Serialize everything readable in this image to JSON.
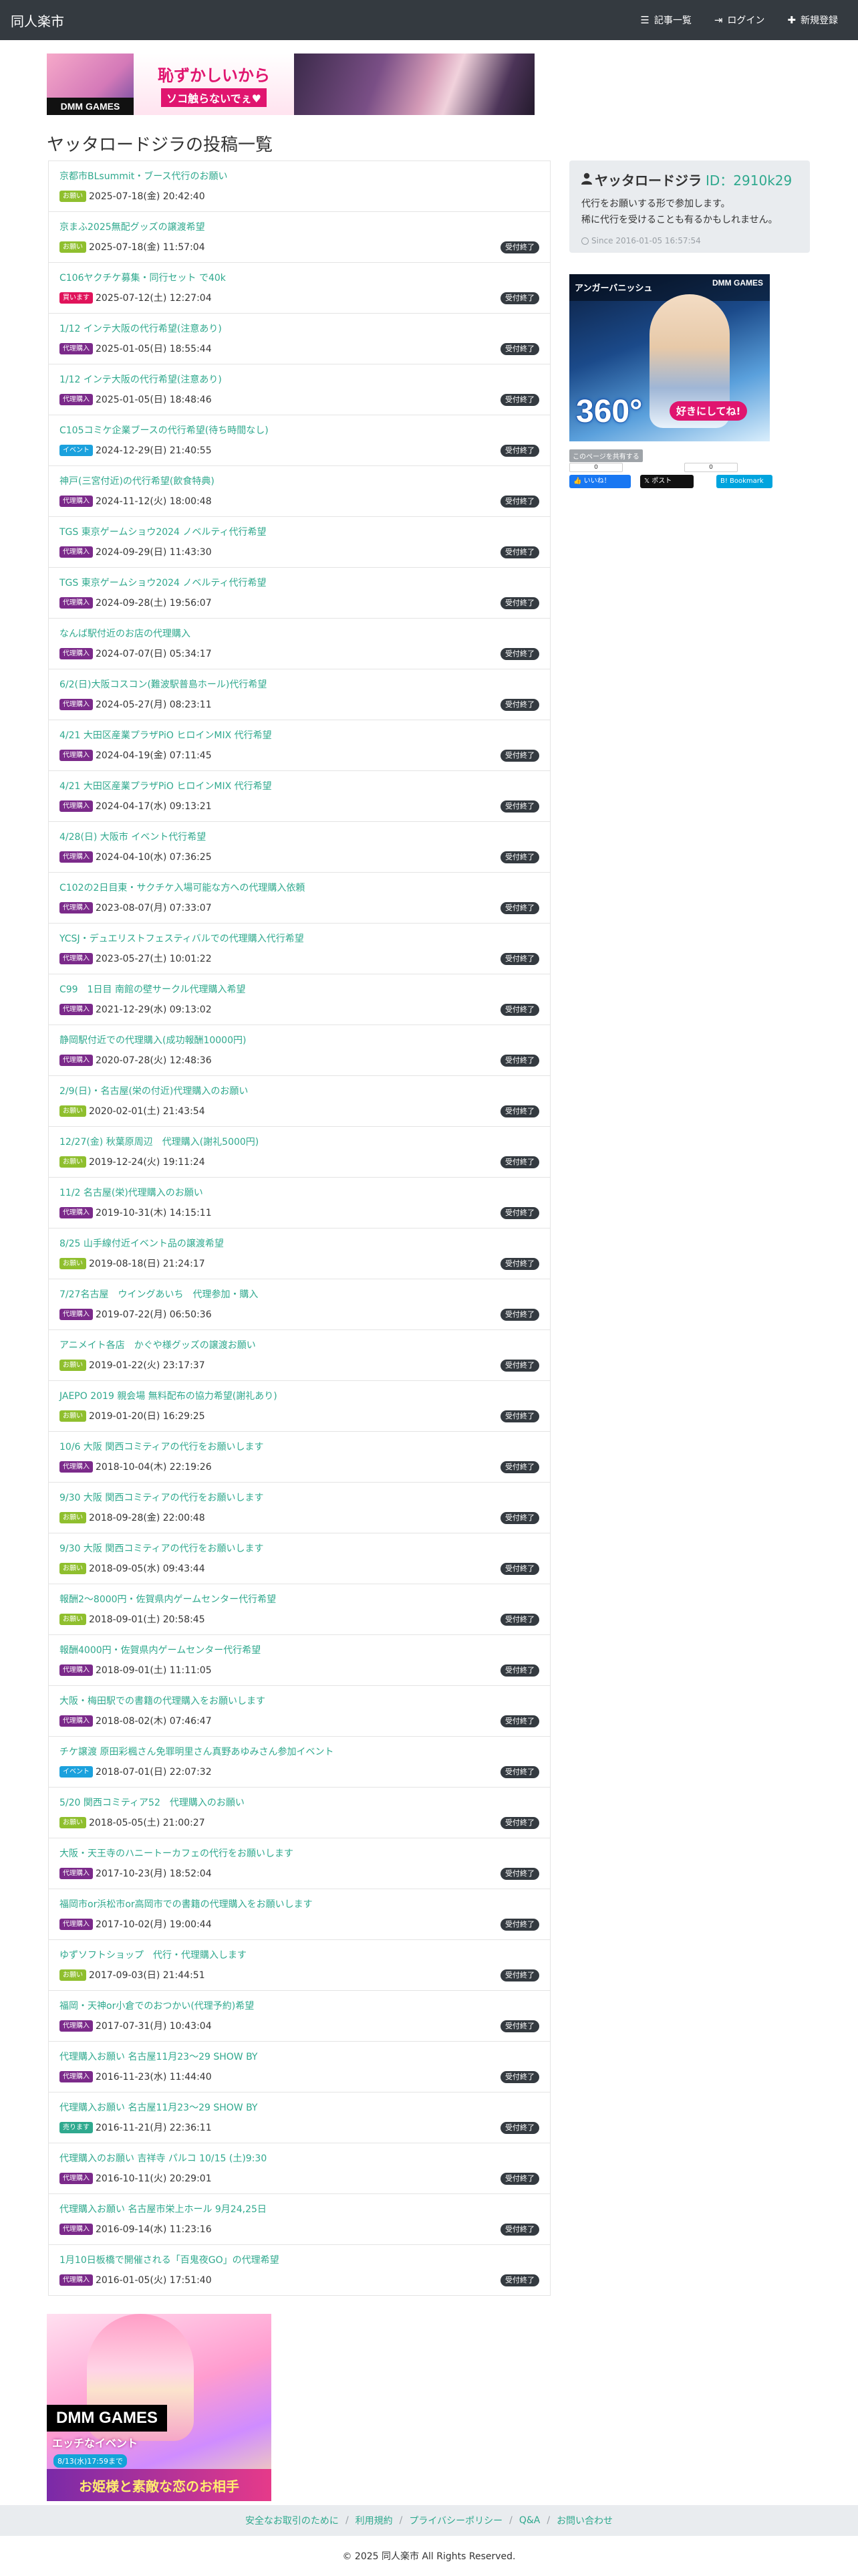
{
  "navbar": {
    "brand": "同人楽市",
    "links": [
      {
        "label": "記事一覧",
        "icon": "list-icon"
      },
      {
        "label": "ログイン",
        "icon": "sign-in-icon"
      },
      {
        "label": "新規登録",
        "icon": "plus-icon"
      }
    ]
  },
  "top_banner": {
    "brand": "DMM GAMES",
    "line1": "恥ずかしいから",
    "line2": "ソコ触らないでぇ♥"
  },
  "page_title": "ヤッタロードジラの投稿一覧",
  "colors": {
    "accent": "#2fa98e",
    "navbar": "#343a40",
    "cat_onegai": "#8fbf2e",
    "cat_daiko": "#7b2a8a",
    "cat_uri": "#e0135a",
    "cat_event": "#1ba1dd",
    "cat_kai": "#2fa98e"
  },
  "posts": [
    {
      "title": "京都市BLsummit・ブース代行のお願い",
      "category": "お願い",
      "cat_type": "onegai",
      "date": "2025-07-18(金) 20:42:40",
      "status": ""
    },
    {
      "title": "京まふ2025無配グッズの譲渡希望",
      "category": "お願い",
      "cat_type": "onegai",
      "date": "2025-07-18(金) 11:57:04",
      "status": "受付終了"
    },
    {
      "title": "C106ヤクチケ募集・同行セット で40k",
      "category": "買います",
      "cat_type": "uri",
      "date": "2025-07-12(土) 12:27:04",
      "status": "受付終了"
    },
    {
      "title": "1/12 インテ大阪の代行希望(注意あり)",
      "category": "代理購入",
      "cat_type": "daiko",
      "date": "2025-01-05(日) 18:55:44",
      "status": "受付終了"
    },
    {
      "title": "1/12 インテ大阪の代行希望(注意あり)",
      "category": "代理購入",
      "cat_type": "daiko",
      "date": "2025-01-05(日) 18:48:46",
      "status": "受付終了"
    },
    {
      "title": "C105コミケ企業ブースの代行希望(待ち時間なし)",
      "category": "イベント",
      "cat_type": "event",
      "date": "2024-12-29(日) 21:40:55",
      "status": "受付終了"
    },
    {
      "title": "神戸(三宮付近)の代行希望(飲食特典)",
      "category": "代理購入",
      "cat_type": "daiko",
      "date": "2024-11-12(火) 18:00:48",
      "status": "受付終了"
    },
    {
      "title": "TGS 東京ゲームショウ2024 ノベルティ代行希望",
      "category": "代理購入",
      "cat_type": "daiko",
      "date": "2024-09-29(日) 11:43:30",
      "status": "受付終了"
    },
    {
      "title": "TGS 東京ゲームショウ2024 ノベルティ代行希望",
      "category": "代理購入",
      "cat_type": "daiko",
      "date": "2024-09-28(土) 19:56:07",
      "status": "受付終了"
    },
    {
      "title": "なんば駅付近のお店の代理購入",
      "category": "代理購入",
      "cat_type": "daiko",
      "date": "2024-07-07(日) 05:34:17",
      "status": "受付終了"
    },
    {
      "title": "6/2(日)大阪コスコン(難波駅普島ホール)代行希望",
      "category": "代理購入",
      "cat_type": "daiko",
      "date": "2024-05-27(月) 08:23:11",
      "status": "受付終了"
    },
    {
      "title": "4/21 大田区産業プラザPiO ヒロインMIX 代行希望",
      "category": "代理購入",
      "cat_type": "daiko",
      "date": "2024-04-19(金) 07:11:45",
      "status": "受付終了"
    },
    {
      "title": "4/21 大田区産業プラザPiO ヒロインMIX 代行希望",
      "category": "代理購入",
      "cat_type": "daiko",
      "date": "2024-04-17(水) 09:13:21",
      "status": "受付終了"
    },
    {
      "title": "4/28(日) 大阪市 イベント代行希望",
      "category": "代理購入",
      "cat_type": "daiko",
      "date": "2024-04-10(水) 07:36:25",
      "status": "受付終了"
    },
    {
      "title": "C102の2日目東・サクチケ入場可能な方への代理購入依頼",
      "category": "代理購入",
      "cat_type": "daiko",
      "date": "2023-08-07(月) 07:33:07",
      "status": "受付終了"
    },
    {
      "title": "YCSJ・デュエリストフェスティバルでの代理購入代行希望",
      "category": "代理購入",
      "cat_type": "daiko",
      "date": "2023-05-27(土) 10:01:22",
      "status": "受付終了"
    },
    {
      "title": "C99　1日目 南館の壁サークル代理購入希望",
      "category": "代理購入",
      "cat_type": "daiko",
      "date": "2021-12-29(水) 09:13:02",
      "status": "受付終了"
    },
    {
      "title": "静岡駅付近での代理購入(成功報酬10000円)",
      "category": "代理購入",
      "cat_type": "daiko",
      "date": "2020-07-28(火) 12:48:36",
      "status": "受付終了"
    },
    {
      "title": "2/9(日)・名古屋(栄の付近)代理購入のお願い",
      "category": "お願い",
      "cat_type": "onegai",
      "date": "2020-02-01(土) 21:43:54",
      "status": "受付終了"
    },
    {
      "title": "12/27(金) 秋葉原周辺　代理購入(謝礼5000円)",
      "category": "お願い",
      "cat_type": "onegai",
      "date": "2019-12-24(火) 19:11:24",
      "status": "受付終了"
    },
    {
      "title": "11/2 名古屋(栄)代理購入のお願い",
      "category": "代理購入",
      "cat_type": "daiko",
      "date": "2019-10-31(木) 14:15:11",
      "status": "受付終了"
    },
    {
      "title": "8/25 山手線付近イベント品の譲渡希望",
      "category": "お願い",
      "cat_type": "onegai",
      "date": "2019-08-18(日) 21:24:17",
      "status": "受付終了"
    },
    {
      "title": "7/27名古屋　ウイングあいち　代理参加・購入",
      "category": "代理購入",
      "cat_type": "daiko",
      "date": "2019-07-22(月) 06:50:36",
      "status": "受付終了"
    },
    {
      "title": "アニメイト各店　かぐや様グッズの譲渡お願い",
      "category": "お願い",
      "cat_type": "onegai",
      "date": "2019-01-22(火) 23:17:37",
      "status": "受付終了"
    },
    {
      "title": "JAEPO 2019 親会場 無料配布の協力希望(謝礼あり)",
      "category": "お願い",
      "cat_type": "onegai",
      "date": "2019-01-20(日) 16:29:25",
      "status": "受付終了"
    },
    {
      "title": "10/6 大阪 関西コミティアの代行をお願いします",
      "category": "代理購入",
      "cat_type": "daiko",
      "date": "2018-10-04(木) 22:19:26",
      "status": "受付終了"
    },
    {
      "title": "9/30 大阪 関西コミティアの代行をお願いします",
      "category": "お願い",
      "cat_type": "onegai",
      "date": "2018-09-28(金) 22:00:48",
      "status": "受付終了"
    },
    {
      "title": "9/30 大阪 関西コミティアの代行をお願いします",
      "category": "お願い",
      "cat_type": "onegai",
      "date": "2018-09-05(水) 09:43:44",
      "status": "受付終了"
    },
    {
      "title": "報酬2～8000円・佐賀県内ゲームセンター代行希望",
      "category": "お願い",
      "cat_type": "onegai",
      "date": "2018-09-01(土) 20:58:45",
      "status": "受付終了"
    },
    {
      "title": "報酬4000円・佐賀県内ゲームセンター代行希望",
      "category": "代理購入",
      "cat_type": "daiko",
      "date": "2018-09-01(土) 11:11:05",
      "status": "受付終了"
    },
    {
      "title": "大阪・梅田駅での書籍の代理購入をお願いします",
      "category": "代理購入",
      "cat_type": "daiko",
      "date": "2018-08-02(木) 07:46:47",
      "status": "受付終了"
    },
    {
      "title": "チケ譲渡 原田彩楓さん免罪明里さん真野あゆみさん参加イベント",
      "category": "イベント",
      "cat_type": "event",
      "date": "2018-07-01(日) 22:07:32",
      "status": "受付終了"
    },
    {
      "title": "5/20 関西コミティア52　代理購入のお願い",
      "category": "お願い",
      "cat_type": "onegai",
      "date": "2018-05-05(土) 21:00:27",
      "status": "受付終了"
    },
    {
      "title": "大阪・天王寺のハニートーカフェの代行をお願いします",
      "category": "代理購入",
      "cat_type": "daiko",
      "date": "2017-10-23(月) 18:52:04",
      "status": "受付終了"
    },
    {
      "title": "福岡市or浜松市or高岡市での書籍の代理購入をお願いします",
      "category": "代理購入",
      "cat_type": "daiko",
      "date": "2017-10-02(月) 19:00:44",
      "status": "受付終了"
    },
    {
      "title": "ゆずソフトショップ　代行・代理購入します",
      "category": "お願い",
      "cat_type": "onegai",
      "date": "2017-09-03(日) 21:44:51",
      "status": "受付終了"
    },
    {
      "title": "福岡・天神or小倉でのおつかい(代理予約)希望",
      "category": "代理購入",
      "cat_type": "daiko",
      "date": "2017-07-31(月) 10:43:04",
      "status": "受付終了"
    },
    {
      "title": "代理購入お願い 名古屋11月23〜29 SHOW BY",
      "category": "代理購入",
      "cat_type": "daiko",
      "date": "2016-11-23(水) 11:44:40",
      "status": "受付終了"
    },
    {
      "title": "代理購入お願い 名古屋11月23〜29 SHOW BY",
      "category": "売ります",
      "cat_type": "kai",
      "date": "2016-11-21(月) 22:36:11",
      "status": "受付終了"
    },
    {
      "title": "代理購入のお願い 吉祥寺 パルコ 10/15 (土)9:30",
      "category": "代理購入",
      "cat_type": "daiko",
      "date": "2016-10-11(火) 20:29:01",
      "status": "受付終了"
    },
    {
      "title": "代理購入お願い 名古屋市栄上ホール 9月24,25日",
      "category": "代理購入",
      "cat_type": "daiko",
      "date": "2016-09-14(水) 11:23:16",
      "status": "受付終了"
    },
    {
      "title": "1月10日板橋で開催される「百鬼夜GO」の代理希望",
      "category": "代理購入",
      "cat_type": "daiko",
      "date": "2016-01-05(火) 17:51:40",
      "status": "受付終了"
    }
  ],
  "profile": {
    "name": "ヤッタロードジラ",
    "id": "ID：2910k29",
    "desc1": "代行をお願いする形で参加します。",
    "desc2": "稀に代行を受けることも有るかもしれません。",
    "since": "Since 2016-01-05 16:57:54"
  },
  "side_ad": {
    "title": "アンガーバニッシュ",
    "brand": "DMM GAMES",
    "big": "360°",
    "sub": "好きにしてね!"
  },
  "share": {
    "label": "このページを共有する",
    "fb_count": "0",
    "hb_count": "0",
    "fb_label": "いいね！",
    "x_label": "ポスト",
    "hb_label": "B! Bookmark"
  },
  "bottom_ad": {
    "brand": "DMM GAMES",
    "event": "エッチなイベント",
    "sub": "8/13(水)17:59まで",
    "title": "お姫様と素敵な恋のお相手"
  },
  "footer": {
    "links": [
      "安全なお取引のために",
      "利用規約",
      "プライバシーポリシー",
      "Q&A",
      "お問い合わせ"
    ],
    "copyright": "© 2025 同人楽市 All Rights Reserved."
  }
}
